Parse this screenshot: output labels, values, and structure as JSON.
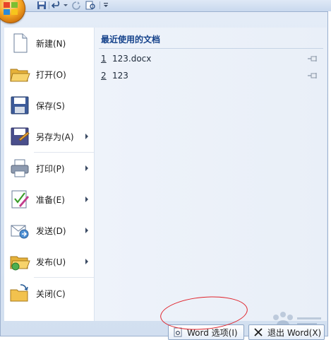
{
  "menu": {
    "commands": [
      {
        "label": "新建(N)",
        "icon": "new-document-icon",
        "submenu": false
      },
      {
        "label": "打开(O)",
        "icon": "open-folder-icon",
        "submenu": false
      },
      {
        "label": "保存(S)",
        "icon": "save-disk-icon",
        "submenu": false
      },
      {
        "label": "另存为(A)",
        "icon": "save-as-icon",
        "submenu": true
      },
      {
        "label": "打印(P)",
        "icon": "printer-icon",
        "submenu": true
      },
      {
        "label": "准备(E)",
        "icon": "prepare-document-icon",
        "submenu": true
      },
      {
        "label": "发送(D)",
        "icon": "send-mail-icon",
        "submenu": true
      },
      {
        "label": "发布(U)",
        "icon": "publish-folder-icon",
        "submenu": true
      },
      {
        "label": "关闭(C)",
        "icon": "close-folder-icon",
        "submenu": false
      }
    ]
  },
  "recent": {
    "title": "最近使用的文档",
    "items": [
      {
        "num": "1",
        "name": "123.docx"
      },
      {
        "num": "2",
        "name": "123"
      }
    ]
  },
  "buttons": {
    "options_label": "Word 选项(I)",
    "exit_label": "退出 Word(X)"
  },
  "colors": {
    "accent": "#15428b",
    "annotation": "#e0222a"
  }
}
